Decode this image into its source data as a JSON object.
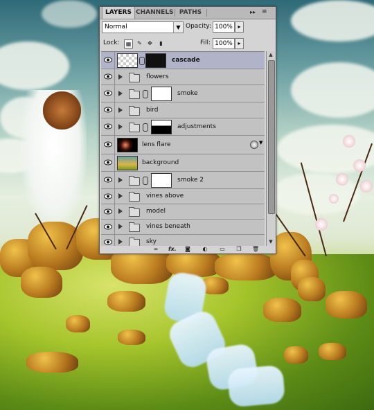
{
  "tabs": [
    {
      "label": "LAYERS",
      "active": true
    },
    {
      "label": "CHANNELS",
      "active": false
    },
    {
      "label": "PATHS",
      "active": false
    }
  ],
  "panel_controls": {
    "collapse_icon": "double-arrow-icon",
    "menu_icon": "panel-menu-icon"
  },
  "blend_mode": {
    "value": "Normal"
  },
  "opacity": {
    "label": "Opacity:",
    "value": "100%"
  },
  "lock": {
    "label": "Lock:"
  },
  "fill": {
    "label": "Fill:",
    "value": "100%"
  },
  "layers": [
    {
      "name": "cascade",
      "type": "layer-mask",
      "selected": true,
      "visible": true
    },
    {
      "name": "flowers",
      "type": "group",
      "visible": true
    },
    {
      "name": "smoke",
      "type": "group-mask",
      "visible": true
    },
    {
      "name": "bird",
      "type": "group",
      "visible": true
    },
    {
      "name": "adjustments",
      "type": "group-mask",
      "visible": true
    },
    {
      "name": "lens flare",
      "type": "layer-fx",
      "visible": true
    },
    {
      "name": "background",
      "type": "layer",
      "visible": true
    },
    {
      "name": "smoke 2",
      "type": "group-mask",
      "visible": true
    },
    {
      "name": "vines above",
      "type": "group",
      "visible": true
    },
    {
      "name": "model",
      "type": "group",
      "visible": true
    },
    {
      "name": "vines beneath",
      "type": "group",
      "visible": true
    },
    {
      "name": "sky",
      "type": "group",
      "visible": true
    }
  ],
  "footer_icons": [
    "link-layers-icon",
    "fx-icon",
    "mask-icon",
    "adjustment-icon",
    "new-group-icon",
    "new-layer-icon",
    "trash-icon"
  ],
  "footer_glyphs": {
    "fx": "fx."
  }
}
